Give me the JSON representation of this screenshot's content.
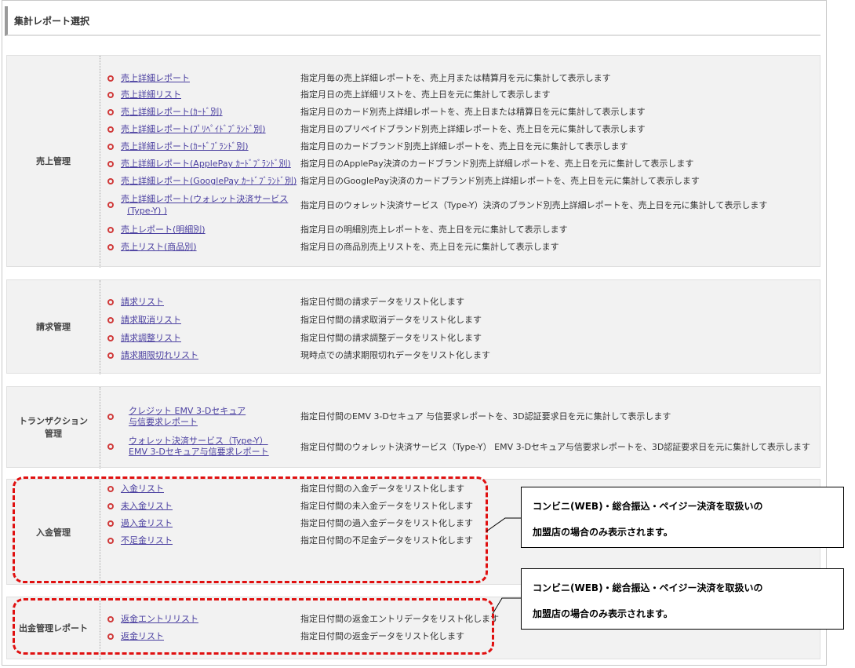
{
  "page_title": "集計レポート選択",
  "sections": [
    {
      "id": "sales",
      "label": "売上管理",
      "items": [
        {
          "link": "売上詳細レポート",
          "desc": "指定月毎の売上詳細レポートを、売上月または精算月を元に集計して表示します"
        },
        {
          "link": "売上詳細リスト",
          "desc": "指定月日の売上詳細リストを、売上日を元に集計して表示します"
        },
        {
          "link": "売上詳細レポート(ｶｰﾄﾞ別)",
          "desc": "指定月日のカード別売上詳細レポートを、売上日または精算日を元に集計して表示します"
        },
        {
          "link": "売上詳細レポート(ﾌﾟﾘﾍﾟｲﾄﾞﾌﾞﾗﾝﾄﾞ別)",
          "desc": "指定月日のプリペイドブランド別売上詳細レポートを、売上日を元に集計して表示します"
        },
        {
          "link": "売上詳細レポート(ｶｰﾄﾞﾌﾞﾗﾝﾄﾞ別)",
          "desc": "指定月日のカードブランド別売上詳細レポートを、売上日を元に集計して表示します"
        },
        {
          "link": "売上詳細レポート(ApplePay ｶｰﾄﾞﾌﾞﾗﾝﾄﾞ別)",
          "desc": "指定月日のApplePay決済のカードブランド別売上詳細レポートを、売上日を元に集計して表示します"
        },
        {
          "link": "売上詳細レポート(GooglePay ｶｰﾄﾞﾌﾞﾗﾝﾄﾞ別)",
          "desc": "指定月日のGooglePay決済のカードブランド別売上詳細レポートを、売上日を元に集計して表示します"
        },
        {
          "link1": "売上詳細レポート(ウォレット決済サービス",
          "link2": "(Type-Y) )",
          "desc": "指定月日のウォレット決済サービス（Type-Y）決済のブランド別売上詳細レポートを、売上日を元に集計して表示します"
        },
        {
          "link": "売上レポート(明細別)",
          "desc": "指定月日の明細別売上レポートを、売上日を元に集計して表示します"
        },
        {
          "link": "売上リスト(商品別)",
          "desc": "指定月日の商品別売上リストを、売上日を元に集計して表示します"
        }
      ]
    },
    {
      "id": "billing",
      "label": "請求管理",
      "items": [
        {
          "link": "請求リスト",
          "desc": "指定日付間の請求データをリスト化します"
        },
        {
          "link": "請求取消リスト",
          "desc": "指定日付間の請求取消データをリスト化します"
        },
        {
          "link": "請求調整リスト",
          "desc": "指定日付間の請求調整データをリスト化します"
        },
        {
          "link": "請求期限切れリスト",
          "desc": "現時点での請求期限切れデータをリスト化します"
        }
      ]
    },
    {
      "id": "transaction",
      "label1": "トランザクション",
      "label2": "管理",
      "items": [
        {
          "link1": "クレジット EMV 3-Dセキュア",
          "link2": "与信要求レポート",
          "desc": "指定日付間のEMV 3-Dセキュア 与信要求レポートを、3D認証要求日を元に集計して表示します"
        },
        {
          "link1": "ウォレット決済サービス（Type-Y）",
          "link2": "EMV 3-Dセキュア与信要求レポート",
          "desc": "指定日付間のウォレット決済サービス（Type-Y） EMV 3-Dセキュア与信要求レポートを、3D認証要求日を元に集計して表示します"
        }
      ]
    },
    {
      "id": "deposit",
      "label": "入金管理",
      "items": [
        {
          "link": "入金リスト",
          "desc": "指定日付間の入金データをリスト化します"
        },
        {
          "link": "未入金リスト",
          "desc": "指定日付間の未入金データをリスト化します"
        },
        {
          "link": "過入金リスト",
          "desc": "指定日付間の過入金データをリスト化します"
        },
        {
          "link": "不足金リスト",
          "desc": "指定日付間の不足金データをリスト化します"
        }
      ]
    },
    {
      "id": "payout",
      "label": "出金管理レポート",
      "items": [
        {
          "link": "返金エントリリスト",
          "desc": "指定日付間の返金エントリデータをリスト化します"
        },
        {
          "link": "返金リスト",
          "desc": "指定日付間の返金データをリスト化します"
        }
      ]
    }
  ],
  "callouts": [
    {
      "line1": "コンビニ(WEB)・総合振込・ペイジー決済を取扱いの",
      "line2": "加盟店の場合のみ表示されます。"
    },
    {
      "line1": "コンビニ(WEB)・総合振込・ペイジー決済を取扱いの",
      "line2": "加盟店の場合のみ表示されます。"
    }
  ],
  "colors": {
    "link": "#4a3fa0",
    "bullet": "#d03a3a",
    "highlight": "#e01010"
  }
}
